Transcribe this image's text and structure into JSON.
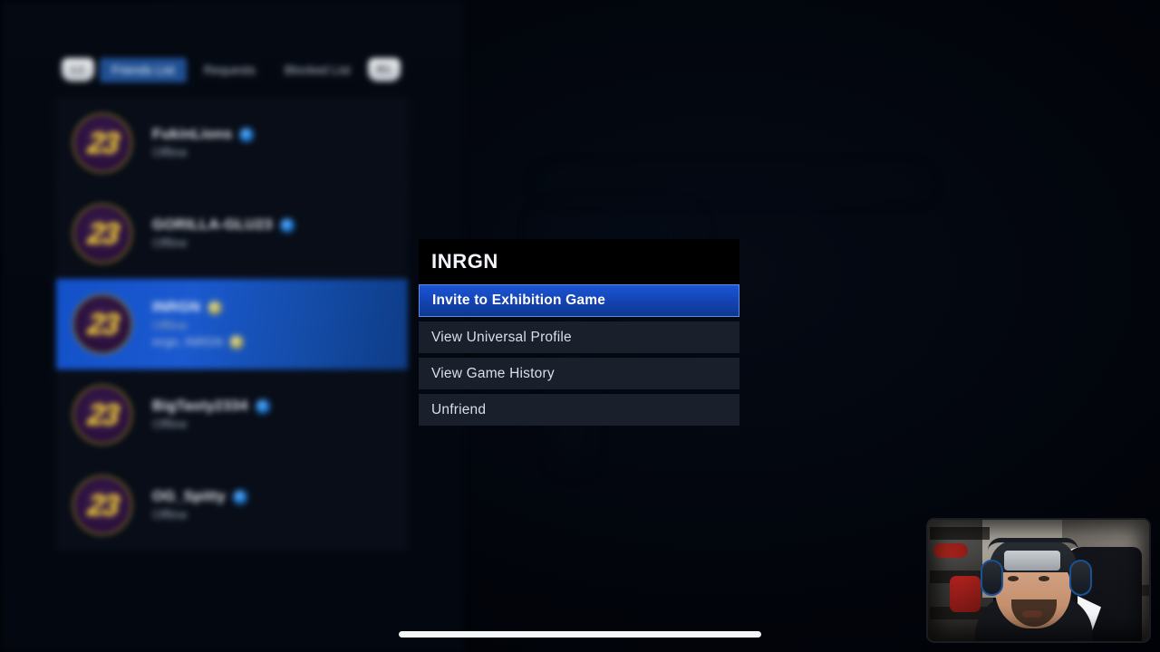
{
  "app": {
    "background_color": "#02050c",
    "accent_color": "#1a56d6"
  },
  "friends_panel": {
    "shoulder_left": "L1",
    "shoulder_right": "R1",
    "tabs": [
      {
        "label": "Friends List",
        "active": true
      },
      {
        "label": "Requests",
        "active": false
      },
      {
        "label": "Blocked List",
        "active": false
      }
    ],
    "avatar_glyph": "23",
    "rows": [
      {
        "name": "FukinLions",
        "status": "Offline",
        "badge": "playstation-badge",
        "sub": null,
        "sub_badge": null,
        "selected": false
      },
      {
        "name": "GORILLA-GLU23",
        "status": "Offline",
        "badge": "playstation-badge",
        "sub": null,
        "sub_badge": null,
        "selected": false
      },
      {
        "name": "INRGN",
        "status": "Offline",
        "badge": "platform-badge",
        "sub": "inrgn, INRGN",
        "sub_badge": "verified-badge",
        "selected": true
      },
      {
        "name": "BigTasty2334",
        "status": "Offline",
        "badge": "playstation-badge",
        "sub": null,
        "sub_badge": null,
        "selected": false
      },
      {
        "name": "OG_Spitty",
        "status": "Offline",
        "badge": "playstation-badge",
        "sub": null,
        "sub_badge": null,
        "selected": false
      }
    ]
  },
  "context_menu": {
    "title": "INRGN",
    "items": [
      {
        "label": "Invite to Exhibition Game",
        "highlighted": true
      },
      {
        "label": "View Universal Profile",
        "highlighted": false
      },
      {
        "label": "View Game History",
        "highlighted": false
      },
      {
        "label": "Unfriend",
        "highlighted": false
      }
    ]
  },
  "overlays": {
    "webcam_present": true,
    "home_indicator_present": true
  }
}
